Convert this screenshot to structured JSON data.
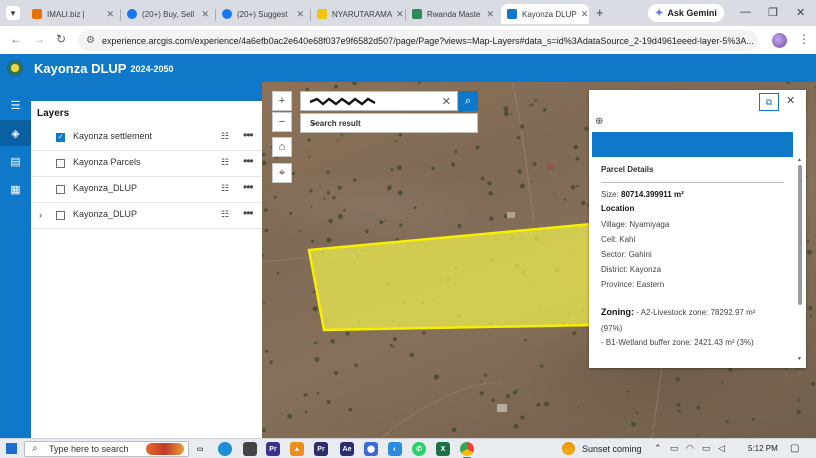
{
  "browser": {
    "tabs": [
      {
        "label": "IMALI.biz |",
        "favicon_color": "#e8710a"
      },
      {
        "label": "(20+) Buy, Sell",
        "favicon_color": "#1877f2"
      },
      {
        "label": "(20+) Suggest",
        "favicon_color": "#1877f2"
      },
      {
        "label": "NYARUTARAMA",
        "favicon_color": "#f1c40f"
      },
      {
        "label": "Rwanda Maste",
        "favicon_color": "#2e8b57"
      },
      {
        "label": "Kayonza DLUP",
        "favicon_color": "#0f78c8",
        "active": true
      }
    ],
    "ask_gemini": "Ask Gemini",
    "url": "experience.arcgis.com/experience/4a6efb0ac2e640e68f037e9f6582d507/page/Page?views=Map-Layers#data_s=id%3AdataSource_2-19d4961eeed-layer-5%3A..."
  },
  "app": {
    "title": "Kayonza DLUP",
    "years": "2024-2050",
    "accent": "#0f78c8"
  },
  "layers_panel": {
    "title": "Layers",
    "items": [
      {
        "label": "Kayonza settlement",
        "checked": true,
        "expandable": false
      },
      {
        "label": "Kayonza Parcels",
        "checked": false,
        "expandable": false
      },
      {
        "label": "Kayonza_DLUP",
        "checked": false,
        "expandable": false
      },
      {
        "label": "Kayonza_DLUP",
        "checked": false,
        "expandable": true
      }
    ]
  },
  "map": {
    "search": {
      "search_result_label": "Search result"
    },
    "parcel_fill": "#f0f050",
    "parcel_stroke": "#f4f000"
  },
  "popup": {
    "heading": "Parcel Details",
    "size_label": "Size:",
    "size_value": "80714.399911 m²",
    "location_label": "Location",
    "village": "Village: Nyamiyaga",
    "cell": "Cell: Kahi",
    "sector": "Sector: Gahini",
    "district": "District: Kayonza",
    "province": "Province: Eastern",
    "zoning_label": "Zoning:",
    "zoning_1": " - A2-Livestock zone: 78292.97 m²",
    "zoning_1_pct": "(97%)",
    "zoning_2": "- B1-Wetland buffer zone: 2421.43 m² (3%)"
  },
  "taskbar": {
    "search_placeholder": "Type here to search",
    "weather": "Sunset coming",
    "time": "5:12 PM"
  }
}
